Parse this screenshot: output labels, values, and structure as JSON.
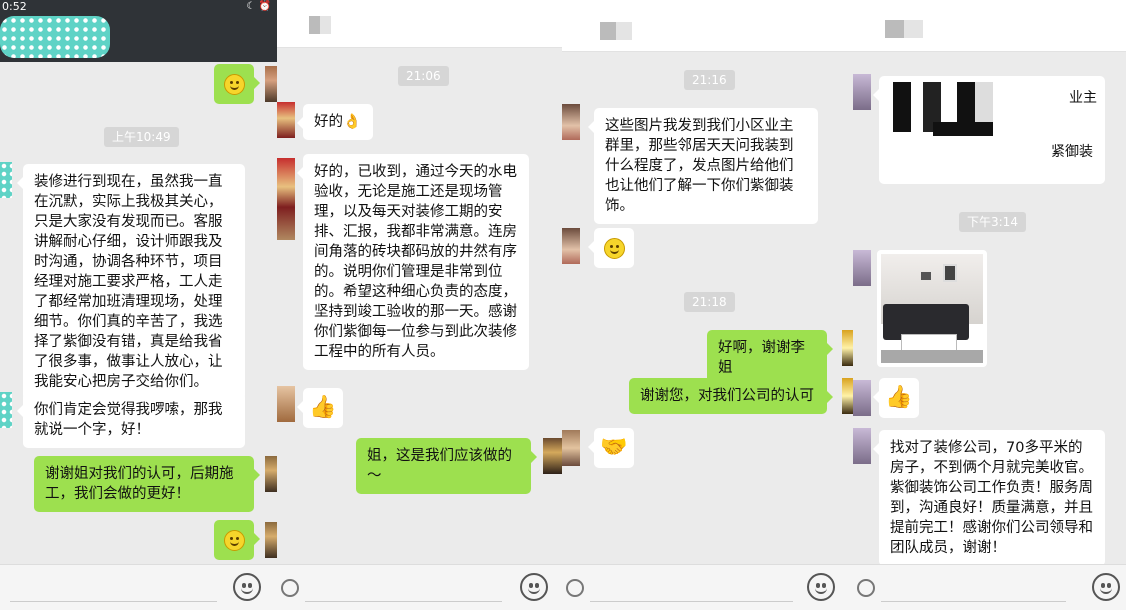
{
  "panel1": {
    "status_time": "0:52",
    "status_icons": "☾ ⏰",
    "timestamp": "上午10:49",
    "msg_long": "装修进行到现在，虽然我一直在沉默，实际上我极其关心，只是大家没有发现而已。客服讲解耐心仔细，设计师跟我及时沟通，协调各种环节，项目经理对施工要求严格，工人走了都经常加班清理现场，处理细节。你们真的辛苦了，我选择了紫御没有错，真是给我省了很多事，做事让人放心，让我能安心把房子交给你们。",
    "msg_2": "你们肯定会觉得我啰嗦，那我就说一个字，好！",
    "reply_1": "谢谢姐对我们的认可，后期施工，我们会做的更好！"
  },
  "panel2": {
    "timestamp": "21:06",
    "msg_ok": "好的👌",
    "msg_long": "好的，已收到，通过今天的水电验收，无论是施工还是现场管理，以及每天对装修工期的安排、汇报，我都非常满意。连房间角落的砖块都码放的井然有序的。说明你们管理是非常到位的。希望这种细心负责的态度，坚持到竣工验收的那一天。感谢你们紫御每一位参与到此次装修工程中的所有人员。",
    "reply_1": "姐，这是我们应该做的～"
  },
  "panel3": {
    "timestamp1": "21:16",
    "msg_long": "这些图片我发到我们小区业主群里，那些邻居天天问我装到什么程度了，发点图片给他们也让他们了解一下你们紫御装饰。",
    "timestamp2": "21:18",
    "reply_1": "好啊，谢谢李姐",
    "reply_2": "谢谢您，对我们公司的认可"
  },
  "panel4": {
    "partial_text": "紧御装",
    "partial_text_top": "业主",
    "timestamp": "下午3:14",
    "msg_long": "找对了装修公司，70多平米的房子，不到俩个月就完美收官。紫御装饰公司工作负责！服务周到，沟通良好！质量满意，并且提前完工！感谢你们公司领导和团队成员，谢谢！"
  },
  "colors": {
    "bubble_green": "#9de04f",
    "bubble_white": "#ffffff",
    "background": "#ebebeb",
    "topbar": "#2f3337"
  },
  "icons": {
    "emoji_button": "smiley-face-icon",
    "thumbs_up": "thumbs-up-icon",
    "handshake": "handshake-icon",
    "ok_hand": "ok-hand-icon"
  }
}
